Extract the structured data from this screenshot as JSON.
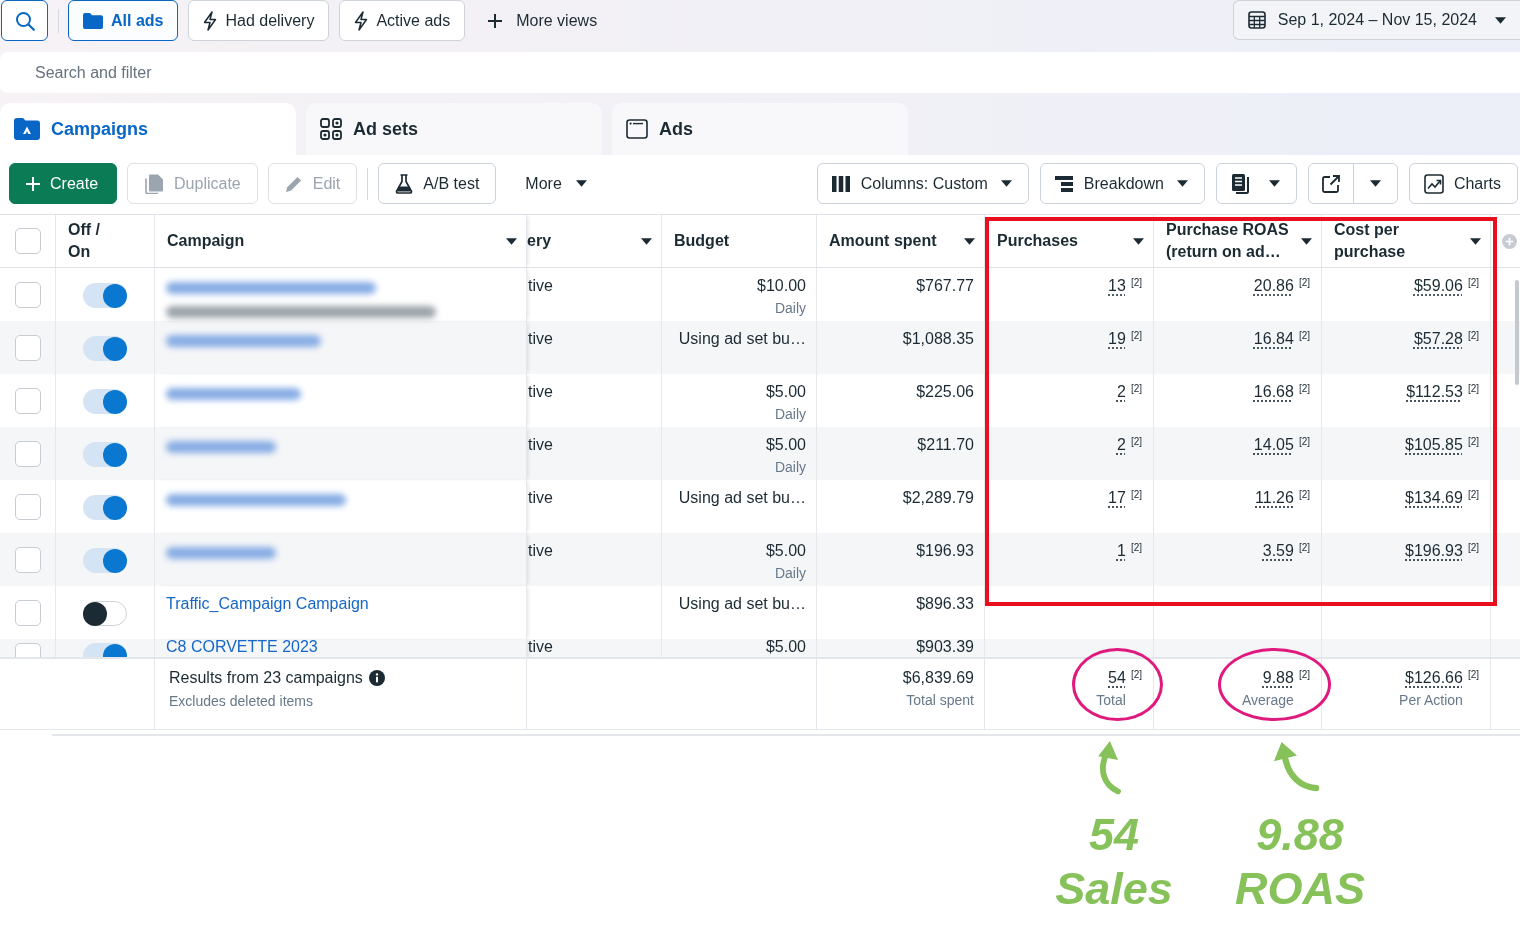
{
  "view_bar": {
    "views": [
      {
        "label": "All ads",
        "selected": true
      },
      {
        "label": "Had delivery",
        "selected": false
      },
      {
        "label": "Active ads",
        "selected": false
      }
    ],
    "more_views": "More views",
    "date_range": "Sep 1, 2024 – Nov 15, 2024"
  },
  "search": {
    "placeholder": "Search and filter"
  },
  "tabs": [
    {
      "label": "Campaigns",
      "selected": true
    },
    {
      "label": "Ad sets",
      "selected": false
    },
    {
      "label": "Ads",
      "selected": false
    }
  ],
  "toolbar": {
    "action_groups": [
      [
        {
          "label": "Create",
          "kind": "primary",
          "disabled": false
        },
        {
          "label": "Duplicate",
          "kind": "button",
          "disabled": true
        },
        {
          "label": "Edit",
          "kind": "button",
          "disabled": true
        }
      ],
      [
        {
          "label": "A/B test",
          "kind": "button",
          "disabled": false
        },
        {
          "label": "More",
          "kind": "menu",
          "disabled": false
        }
      ]
    ],
    "view_controls": [
      {
        "label": "Columns: Custom",
        "kind": "menu"
      },
      {
        "label": "Breakdown",
        "kind": "menu"
      },
      {
        "kind": "iconmenu"
      },
      {
        "kind": "split"
      },
      {
        "label": "Charts",
        "kind": "button"
      }
    ]
  },
  "table": {
    "select_all": {
      "checked": false
    },
    "columns": [
      {
        "label": "Off / On",
        "dropdown": false,
        "highlighted": false
      },
      {
        "label": "Campaign",
        "dropdown": true,
        "highlighted": false
      },
      {
        "label": "ery",
        "dropdown": true,
        "highlighted": false
      },
      {
        "label": "Budget",
        "dropdown": false,
        "highlighted": false
      },
      {
        "label": "Amount spent",
        "dropdown": true,
        "highlighted": false
      },
      {
        "label": "Purchases",
        "dropdown": true,
        "highlighted": true
      },
      {
        "label": "Purchase ROAS (return on ad…",
        "dropdown": true,
        "highlighted": true
      },
      {
        "label": "Cost per purchase",
        "dropdown": true,
        "highlighted": true
      }
    ],
    "rows": [
      {
        "checked": false,
        "on": true,
        "campaign": {
          "blurred": true
        },
        "column_4": "tive",
        "budget": {
          "value": "$10.00",
          "period": "Daily"
        },
        "amount_spent": "$767.77",
        "purchases": {
          "value": "13",
          "note": "[2]"
        },
        "purchase_roas": {
          "value": "20.86",
          "note": "[2]"
        },
        "cost_per_purchase": {
          "value": "$59.06",
          "note": "[2]"
        }
      },
      {
        "checked": false,
        "on": true,
        "campaign": {
          "blurred": true
        },
        "column_4": "tive",
        "budget": {
          "value": "Using ad set bu…"
        },
        "amount_spent": "$1,088.35",
        "purchases": {
          "value": "19",
          "note": "[2]"
        },
        "purchase_roas": {
          "value": "16.84",
          "note": "[2]"
        },
        "cost_per_purchase": {
          "value": "$57.28",
          "note": "[2]"
        }
      },
      {
        "checked": false,
        "on": true,
        "campaign": {
          "blurred": true
        },
        "column_4": "tive",
        "budget": {
          "value": "$5.00",
          "period": "Daily"
        },
        "amount_spent": "$225.06",
        "purchases": {
          "value": "2",
          "note": "[2]"
        },
        "purchase_roas": {
          "value": "16.68",
          "note": "[2]"
        },
        "cost_per_purchase": {
          "value": "$112.53",
          "note": "[2]"
        }
      },
      {
        "checked": false,
        "on": true,
        "campaign": {
          "blurred": true
        },
        "column_4": "tive",
        "budget": {
          "value": "$5.00",
          "period": "Daily"
        },
        "amount_spent": "$211.70",
        "purchases": {
          "value": "2",
          "note": "[2]"
        },
        "purchase_roas": {
          "value": "14.05",
          "note": "[2]"
        },
        "cost_per_purchase": {
          "value": "$105.85",
          "note": "[2]"
        }
      },
      {
        "checked": false,
        "on": true,
        "campaign": {
          "blurred": true
        },
        "column_4": "tive",
        "budget": {
          "value": "Using ad set bu…"
        },
        "amount_spent": "$2,289.79",
        "purchases": {
          "value": "17",
          "note": "[2]"
        },
        "purchase_roas": {
          "value": "11.26",
          "note": "[2]"
        },
        "cost_per_purchase": {
          "value": "$134.69",
          "note": "[2]"
        }
      },
      {
        "checked": false,
        "on": true,
        "campaign": {
          "blurred": true
        },
        "column_4": "tive",
        "budget": {
          "value": "$5.00",
          "period": "Daily"
        },
        "amount_spent": "$196.93",
        "purchases": {
          "value": "1",
          "note": "[2]"
        },
        "purchase_roas": {
          "value": "3.59",
          "note": "[2]"
        },
        "cost_per_purchase": {
          "value": "$196.93",
          "note": "[2]"
        }
      },
      {
        "checked": false,
        "on": false,
        "campaign": {
          "name": "Traffic_Campaign Campaign",
          "blurred": false
        },
        "budget": {
          "value": "Using ad set bu…"
        },
        "amount_spent": "$896.33"
      },
      {
        "checked": false,
        "on": true,
        "campaign": {
          "name": "C8 CORVETTE 2023",
          "blurred": false
        },
        "column_4": "tive",
        "budget": {
          "value": "$5.00"
        },
        "amount_spent": "$903.39"
      }
    ],
    "summary": {
      "text": "Results from 23 campaigns",
      "note": "Excludes deleted items",
      "amount_spent": {
        "value": "$6,839.69",
        "label": "Total spent",
        "circled": false
      },
      "purchases": {
        "value": "54",
        "note": "[2]",
        "label": "Total",
        "circled": true,
        "callout": {
          "value": "54",
          "label": "Sales"
        }
      },
      "purchase_roas": {
        "value": "9.88",
        "note": "[2]",
        "label": "Average",
        "circled": true,
        "callout": {
          "value": "9.88",
          "label": "ROAS"
        }
      },
      "cost_per_purchase": {
        "value": "$126.66",
        "note": "[2]",
        "label": "Per Action",
        "circled": false
      }
    }
  }
}
